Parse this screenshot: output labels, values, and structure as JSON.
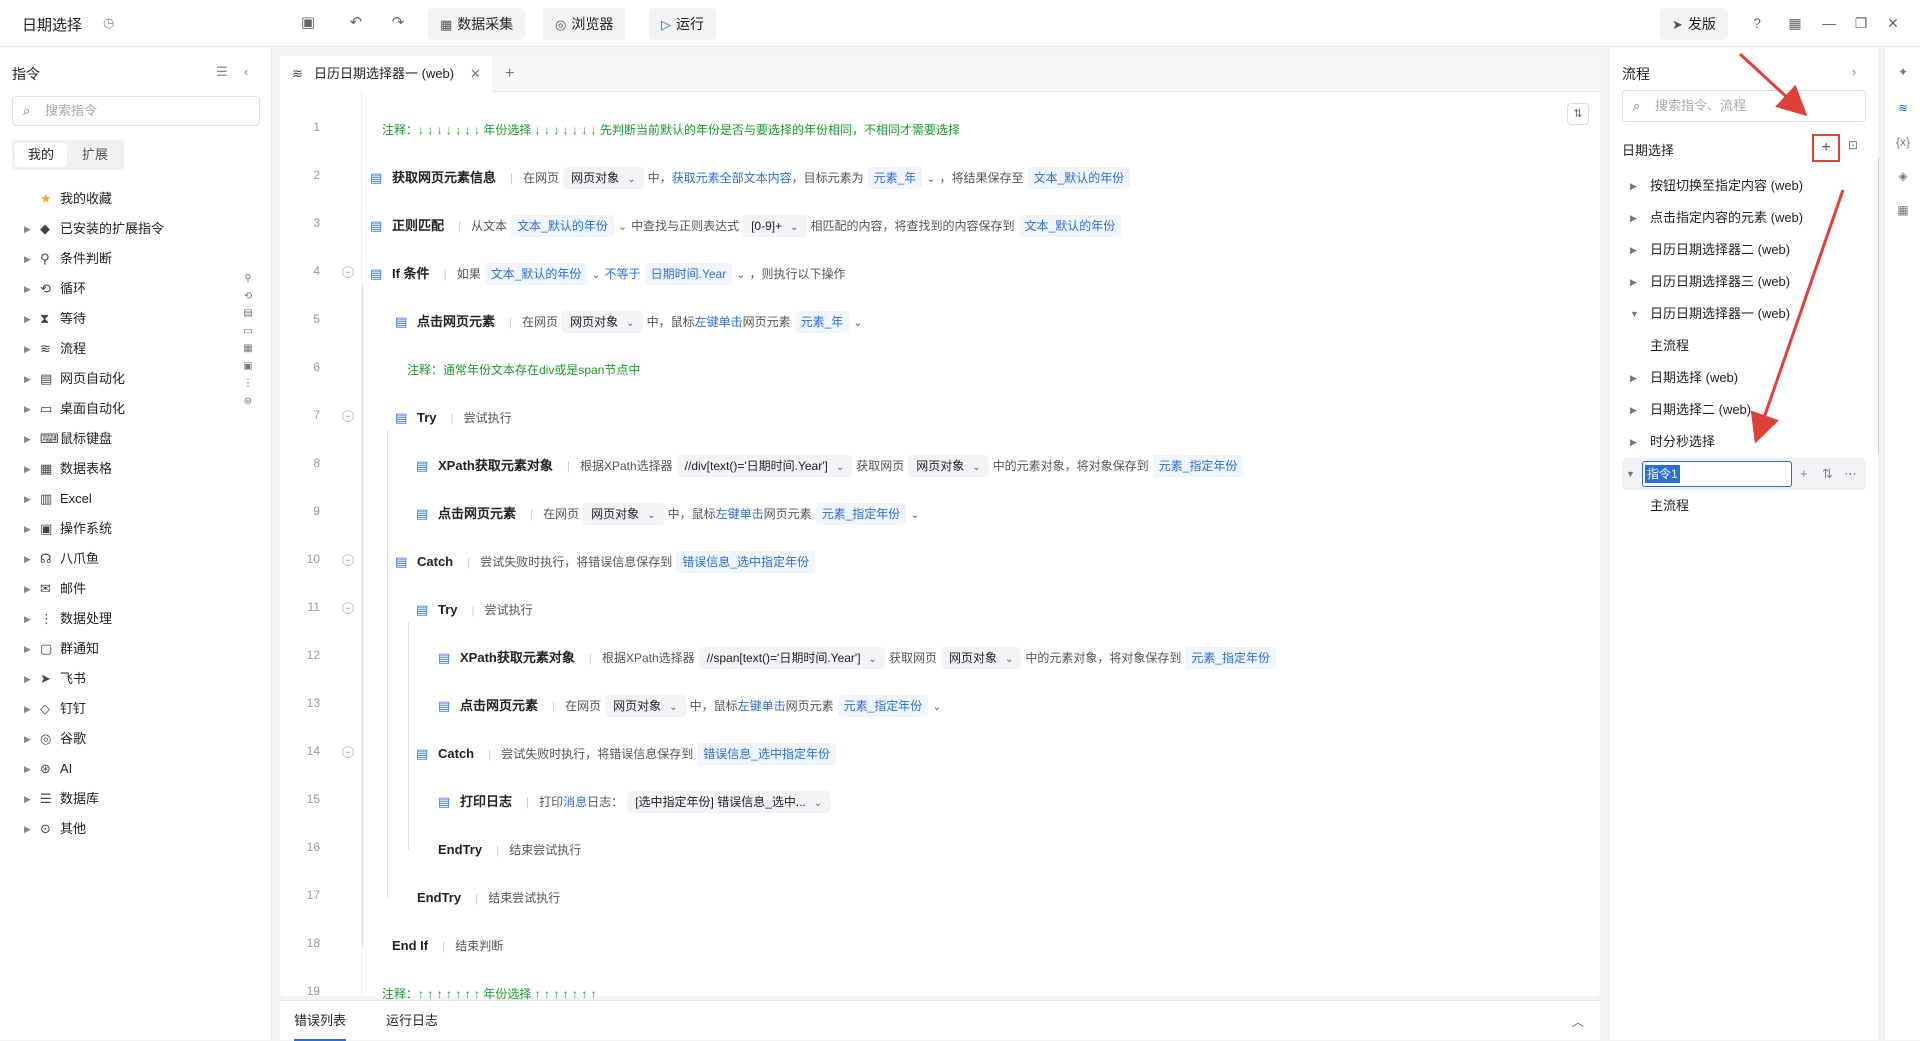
{
  "topbar": {
    "title": "日期选择",
    "history_icon": "history-icon",
    "buttons": [
      "数据采集",
      "浏览器",
      "运行"
    ],
    "publish": "发版"
  },
  "left": {
    "title": "指令",
    "search_placeholder": "搜索指令",
    "tabs": [
      "我的",
      "扩展"
    ],
    "items": [
      {
        "label": "我的收藏",
        "icon": "★",
        "caret": false
      },
      {
        "label": "已安装的扩展指令",
        "icon": "◆",
        "caret": true
      },
      {
        "label": "条件判断",
        "icon": "⚲",
        "caret": true
      },
      {
        "label": "循环",
        "icon": "⟲",
        "caret": true
      },
      {
        "label": "等待",
        "icon": "⧗",
        "caret": true
      },
      {
        "label": "流程",
        "icon": "≋",
        "caret": true
      },
      {
        "label": "网页自动化",
        "icon": "▤",
        "caret": true
      },
      {
        "label": "桌面自动化",
        "icon": "▭",
        "caret": true
      },
      {
        "label": "鼠标键盘",
        "icon": "⌨",
        "caret": true
      },
      {
        "label": "数据表格",
        "icon": "▦",
        "caret": true
      },
      {
        "label": "Excel",
        "icon": "▥",
        "caret": true
      },
      {
        "label": "操作系统",
        "icon": "▣",
        "caret": true
      },
      {
        "label": "八爪鱼",
        "icon": "☊",
        "caret": true
      },
      {
        "label": "邮件",
        "icon": "✉",
        "caret": true
      },
      {
        "label": "数据处理",
        "icon": "⋮",
        "caret": true
      },
      {
        "label": "群通知",
        "icon": "▢",
        "caret": true
      },
      {
        "label": "飞书",
        "icon": "➤",
        "caret": true
      },
      {
        "label": "钉钉",
        "icon": "◇",
        "caret": true
      },
      {
        "label": "谷歌",
        "icon": "◎",
        "caret": true
      },
      {
        "label": "AI",
        "icon": "⊛",
        "caret": true
      },
      {
        "label": "数据库",
        "icon": "☰",
        "caret": true
      },
      {
        "label": "其他",
        "icon": "⊙",
        "caret": true
      }
    ]
  },
  "editor": {
    "tab": "日历日期选择器一 (web)",
    "rows": [
      {
        "n": "1",
        "indent": 0,
        "type": "comment",
        "text": "注释：↓ ↓ ↓ ↓ ↓ ↓ ↓  年份选择  ↓ ↓ ↓ ↓ ↓ ↓ ↓  先判断当前默认的年份是否与要选择的年份相同，不相同才需要选择"
      },
      {
        "n": "2",
        "indent": 0,
        "type": "cmd",
        "cmd": "获取网页元素信息",
        "parts": [
          [
            "t",
            "在网页"
          ],
          [
            "s",
            "网页对象"
          ],
          [
            "t",
            "中，"
          ],
          [
            "l",
            "获取元素全部文本内容"
          ],
          [
            "t",
            "，目标元素为"
          ],
          [
            "v",
            "元素_年"
          ],
          [
            "d",
            ""
          ],
          [
            "t",
            "，将结果保存至"
          ],
          [
            "v",
            "文本_默认的年份"
          ]
        ]
      },
      {
        "n": "3",
        "indent": 0,
        "type": "cmd",
        "cmd": "正则匹配",
        "parts": [
          [
            "t",
            "从文本"
          ],
          [
            "v",
            "文本_默认的年份"
          ],
          [
            "d",
            ""
          ],
          [
            "t",
            "中查找与正则表达式"
          ],
          [
            "s",
            "[0-9]+"
          ],
          [
            "t",
            "相匹配的内容，将查找到的内容保存到"
          ],
          [
            "v",
            "文本_默认的年份"
          ]
        ]
      },
      {
        "n": "4",
        "indent": 0,
        "type": "cmd",
        "cmd": "If 条件",
        "fold": true,
        "parts": [
          [
            "t",
            "如果"
          ],
          [
            "v",
            "文本_默认的年份"
          ],
          [
            "d",
            ""
          ],
          [
            "l",
            "不等于"
          ],
          [
            "v",
            "日期时间.Year"
          ],
          [
            "d",
            ""
          ],
          [
            "t",
            "，则执行以下操作"
          ]
        ]
      },
      {
        "n": "5",
        "indent": 1,
        "type": "cmd",
        "cmd": "点击网页元素",
        "parts": [
          [
            "t",
            "在网页"
          ],
          [
            "s",
            "网页对象"
          ],
          [
            "t",
            "中，鼠标"
          ],
          [
            "l",
            "左键单击"
          ],
          [
            "t",
            "网页元素"
          ],
          [
            "v",
            "元素_年"
          ],
          [
            "d",
            ""
          ]
        ]
      },
      {
        "n": "6",
        "indent": 1,
        "type": "comment",
        "text": "注释：通常年份文本存在div或是span节点中"
      },
      {
        "n": "7",
        "indent": 1,
        "type": "cmd",
        "cmd": "Try",
        "fold": true,
        "parts": [
          [
            "t",
            "尝试执行"
          ]
        ]
      },
      {
        "n": "8",
        "indent": 2,
        "type": "cmd",
        "cmd": "XPath获取元素对象",
        "parts": [
          [
            "t",
            "根据XPath选择器"
          ],
          [
            "s",
            "//div[text()='日期时间.Year']"
          ],
          [
            "t",
            "获取网页"
          ],
          [
            "s",
            "网页对象"
          ],
          [
            "t",
            "中的元素对象，将对象保存到"
          ],
          [
            "v",
            "元素_指定年份"
          ]
        ]
      },
      {
        "n": "9",
        "indent": 2,
        "type": "cmd",
        "cmd": "点击网页元素",
        "parts": [
          [
            "t",
            "在网页"
          ],
          [
            "s",
            "网页对象"
          ],
          [
            "t",
            "中，鼠标"
          ],
          [
            "l",
            "左键单击"
          ],
          [
            "t",
            "网页元素"
          ],
          [
            "v",
            "元素_指定年份"
          ],
          [
            "d",
            ""
          ]
        ]
      },
      {
        "n": "10",
        "indent": 1,
        "type": "cmd",
        "cmd": "Catch",
        "fold": true,
        "parts": [
          [
            "t",
            "尝试失败时执行，将错误信息保存到"
          ],
          [
            "v",
            "错误信息_选中指定年份"
          ]
        ]
      },
      {
        "n": "11",
        "indent": 2,
        "type": "cmd",
        "cmd": "Try",
        "fold": true,
        "parts": [
          [
            "t",
            "尝试执行"
          ]
        ]
      },
      {
        "n": "12",
        "indent": 3,
        "type": "cmd",
        "cmd": "XPath获取元素对象",
        "parts": [
          [
            "t",
            "根据XPath选择器"
          ],
          [
            "s",
            "//span[text()='日期时间.Year']"
          ],
          [
            "t",
            "获取网页"
          ],
          [
            "s",
            "网页对象"
          ],
          [
            "t",
            "中的元素对象，将对象保存到"
          ],
          [
            "v",
            "元素_指定年份"
          ]
        ]
      },
      {
        "n": "13",
        "indent": 3,
        "type": "cmd",
        "cmd": "点击网页元素",
        "parts": [
          [
            "t",
            "在网页"
          ],
          [
            "s",
            "网页对象"
          ],
          [
            "t",
            "中，鼠标"
          ],
          [
            "l",
            "左键单击"
          ],
          [
            "t",
            "网页元素"
          ],
          [
            "v",
            "元素_指定年份"
          ],
          [
            "d",
            ""
          ]
        ]
      },
      {
        "n": "14",
        "indent": 2,
        "type": "cmd",
        "cmd": "Catch",
        "fold": true,
        "parts": [
          [
            "t",
            "尝试失败时执行，将错误信息保存到"
          ],
          [
            "v",
            "错误信息_选中指定年份"
          ]
        ]
      },
      {
        "n": "15",
        "indent": 3,
        "type": "cmd",
        "cmd": "打印日志",
        "parts": [
          [
            "t",
            "打印"
          ],
          [
            "l",
            "消息"
          ],
          [
            "t",
            "日志："
          ],
          [
            "s",
            "[选中指定年份] 错误信息_选中..."
          ]
        ]
      },
      {
        "n": "16",
        "indent": 2,
        "type": "cmd",
        "cmd": "EndTry",
        "noicon": true,
        "parts": [
          [
            "t",
            "结束尝试执行"
          ]
        ]
      },
      {
        "n": "17",
        "indent": 1,
        "type": "cmd",
        "cmd": "EndTry",
        "noicon": true,
        "parts": [
          [
            "t",
            "结束尝试执行"
          ]
        ]
      },
      {
        "n": "18",
        "indent": 0,
        "type": "cmd",
        "cmd": "End If",
        "noicon": true,
        "parts": [
          [
            "t",
            "结束判断"
          ]
        ]
      },
      {
        "n": "19",
        "indent": 0,
        "type": "comment",
        "text": "注释：↑ ↑ ↑ ↑ ↑ ↑ ↑  年份选择  ↑ ↑ ↑ ↑ ↑ ↑ ↑"
      }
    ]
  },
  "bottom": {
    "tabs": [
      "错误列表",
      "运行日志"
    ]
  },
  "right": {
    "title": "流程",
    "search_placeholder": "搜索指令、流程",
    "section": "日期选择",
    "items": [
      {
        "label": "按钮切换至指定内容 (web)",
        "caret": "▶",
        "level": 0
      },
      {
        "label": "点击指定内容的元素 (web)",
        "caret": "▶",
        "level": 0
      },
      {
        "label": "日历日期选择器二 (web)",
        "caret": "▶",
        "level": 0
      },
      {
        "label": "日历日期选择器三 (web)",
        "caret": "▶",
        "level": 0
      },
      {
        "label": "日历日期选择器一 (web)",
        "caret": "▼",
        "level": 0
      },
      {
        "label": "主流程",
        "caret": "",
        "level": 1
      },
      {
        "label": "日期选择 (web)",
        "caret": "▶",
        "level": 0
      },
      {
        "label": "日期选择二 (web)",
        "caret": "▶",
        "level": 0
      },
      {
        "label": "时分秒选择",
        "caret": "▶",
        "level": 0
      }
    ],
    "editing": "指令1",
    "after": "主流程"
  }
}
